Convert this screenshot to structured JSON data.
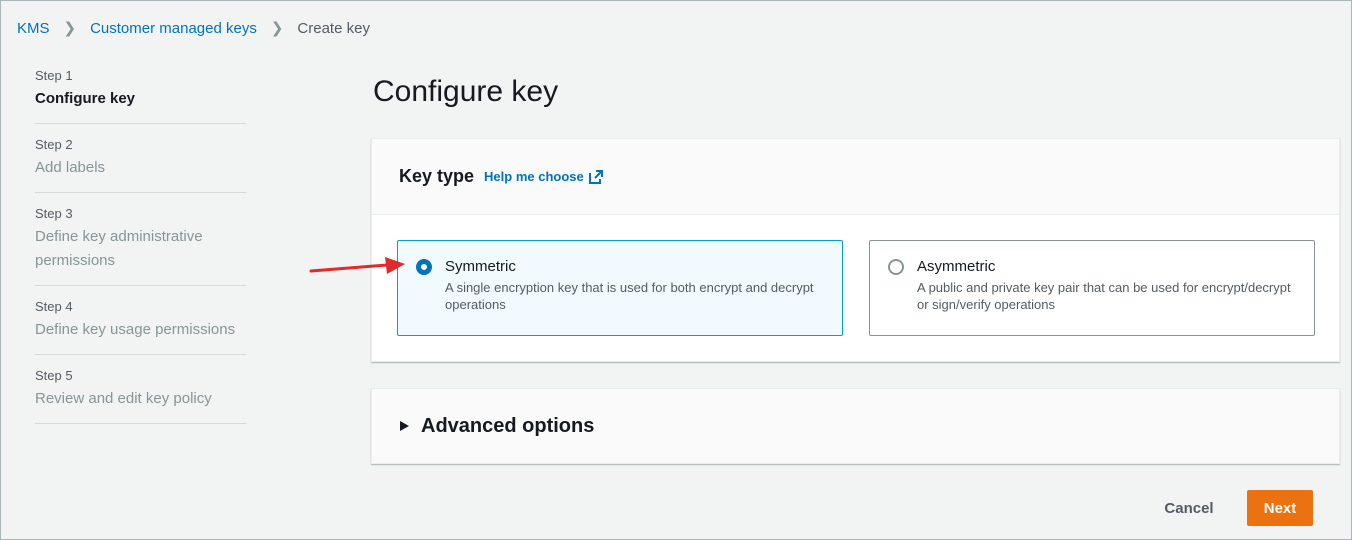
{
  "breadcrumb": {
    "items": [
      "KMS",
      "Customer managed keys"
    ],
    "current": "Create key"
  },
  "steps": [
    {
      "num": "Step 1",
      "label": "Configure key",
      "active": true
    },
    {
      "num": "Step 2",
      "label": "Add labels"
    },
    {
      "num": "Step 3",
      "label": "Define key administrative permissions"
    },
    {
      "num": "Step 4",
      "label": "Define key usage permissions"
    },
    {
      "num": "Step 5",
      "label": "Review and edit key policy"
    }
  ],
  "page": {
    "title": "Configure key"
  },
  "key_type": {
    "heading": "Key type",
    "help": "Help me choose",
    "options": [
      {
        "title": "Symmetric",
        "desc": "A single encryption key that is used for both encrypt and decrypt operations",
        "selected": true
      },
      {
        "title": "Asymmetric",
        "desc": "A public and private key pair that can be used for encrypt/decrypt or sign/verify operations",
        "selected": false
      }
    ]
  },
  "advanced": {
    "label": "Advanced options"
  },
  "actions": {
    "cancel": "Cancel",
    "next": "Next"
  },
  "colors": {
    "accent": "#0073bb",
    "primary_button": "#ec7211",
    "annotation_arrow": "#e02b2b"
  }
}
